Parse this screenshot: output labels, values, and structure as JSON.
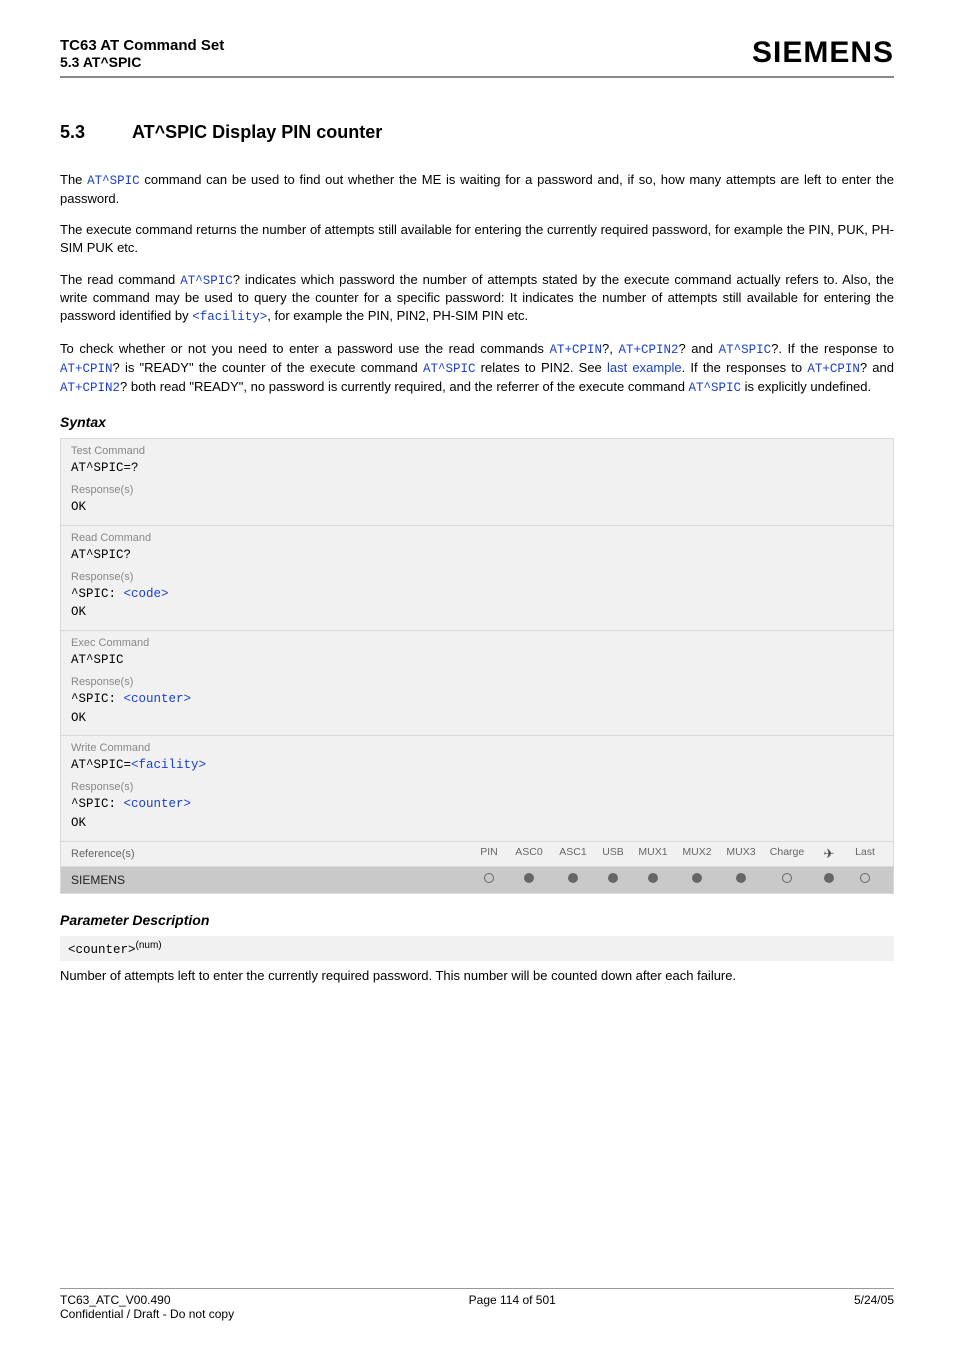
{
  "header": {
    "title": "TC63 AT Command Set",
    "subtitle": "5.3 AT^SPIC",
    "logo": "SIEMENS"
  },
  "section": {
    "num": "5.3",
    "title": "AT^SPIC   Display PIN counter"
  },
  "paragraphs": {
    "p1a": "The ",
    "p1cmd": "AT^SPIC",
    "p1b": " command can be used to find out whether the ME is waiting for a password and, if so, how many attempts are left to enter the password.",
    "p2": "The execute command returns the number of attempts still available for entering the currently required password, for example the PIN, PUK, PH-SIM PUK etc.",
    "p3a": "The read command ",
    "p3cmd": "AT^SPIC",
    "p3b": "? indicates which password the number of attempts stated by the execute command actually refers to. Also, the write command may be used to query the counter for a specific password: It indicates the number of attempts still available for entering the password identified by ",
    "p3fac": "<facility>",
    "p3c": ", for example the PIN, PIN2, PH-SIM PIN etc.",
    "p4a": "To check whether or not you need to enter a password use the read commands ",
    "p4cpin": "AT+CPIN",
    "p4b": "?, ",
    "p4cpin2": "AT+CPIN2",
    "p4c": "? and ",
    "p4spic": "AT^SPIC",
    "p4d": "?. If the response to ",
    "p4cpin_b": "AT+CPIN",
    "p4e": "? is \"READY\" the counter of the execute command ",
    "p4spic_b": "AT^SPIC",
    "p4f": " relates to PIN2. See ",
    "p4last": "last example",
    "p4g": ". If the responses to ",
    "p4cpin_c": "AT+CPIN",
    "p4h": "? and ",
    "p4cpin2_b": "AT+CPIN2",
    "p4i": "? both read \"READY\", no password is currently required, and the referrer of the execute command ",
    "p4spic_c": "AT^SPIC",
    "p4j": " is explicitly undefined."
  },
  "syntaxHeading": "Syntax",
  "syntax": {
    "test": {
      "label": "Test Command",
      "cmd": "AT^SPIC=?",
      "respLabel": "Response(s)",
      "resp1": "OK"
    },
    "read": {
      "label": "Read Command",
      "cmd": "AT^SPIC?",
      "respLabel": "Response(s)",
      "prefix": "^SPIC: ",
      "param": "<code>",
      "resp2": "OK"
    },
    "exec": {
      "label": "Exec Command",
      "cmd": "AT^SPIC",
      "respLabel": "Response(s)",
      "prefix": "^SPIC: ",
      "param": "<counter>",
      "resp2": "OK"
    },
    "write": {
      "label": "Write Command",
      "cmdPrefix": "AT^SPIC=",
      "cmdParam": "<facility>",
      "respLabel": "Response(s)",
      "prefix": "^SPIC: ",
      "param": "<counter>",
      "resp2": "OK"
    },
    "ref": {
      "label": "Reference(s)",
      "vendor": "SIEMENS",
      "cols": [
        "PIN",
        "ASC0",
        "ASC1",
        "USB",
        "MUX1",
        "MUX2",
        "MUX3",
        "Charge",
        "✈",
        "Last"
      ],
      "dots": [
        "empty",
        "filled",
        "filled",
        "filled",
        "filled",
        "filled",
        "filled",
        "empty",
        "filled",
        "empty"
      ]
    }
  },
  "paramHeading": "Parameter Description",
  "param": {
    "name": "<counter>",
    "tag": "(num)",
    "desc": "Number of attempts left to enter the currently required password. This number will be counted down after each failure."
  },
  "footer": {
    "left": "TC63_ATC_V00.490",
    "center": "Page 114 of 501",
    "right": "5/24/05",
    "sub": "Confidential / Draft - Do not copy"
  }
}
